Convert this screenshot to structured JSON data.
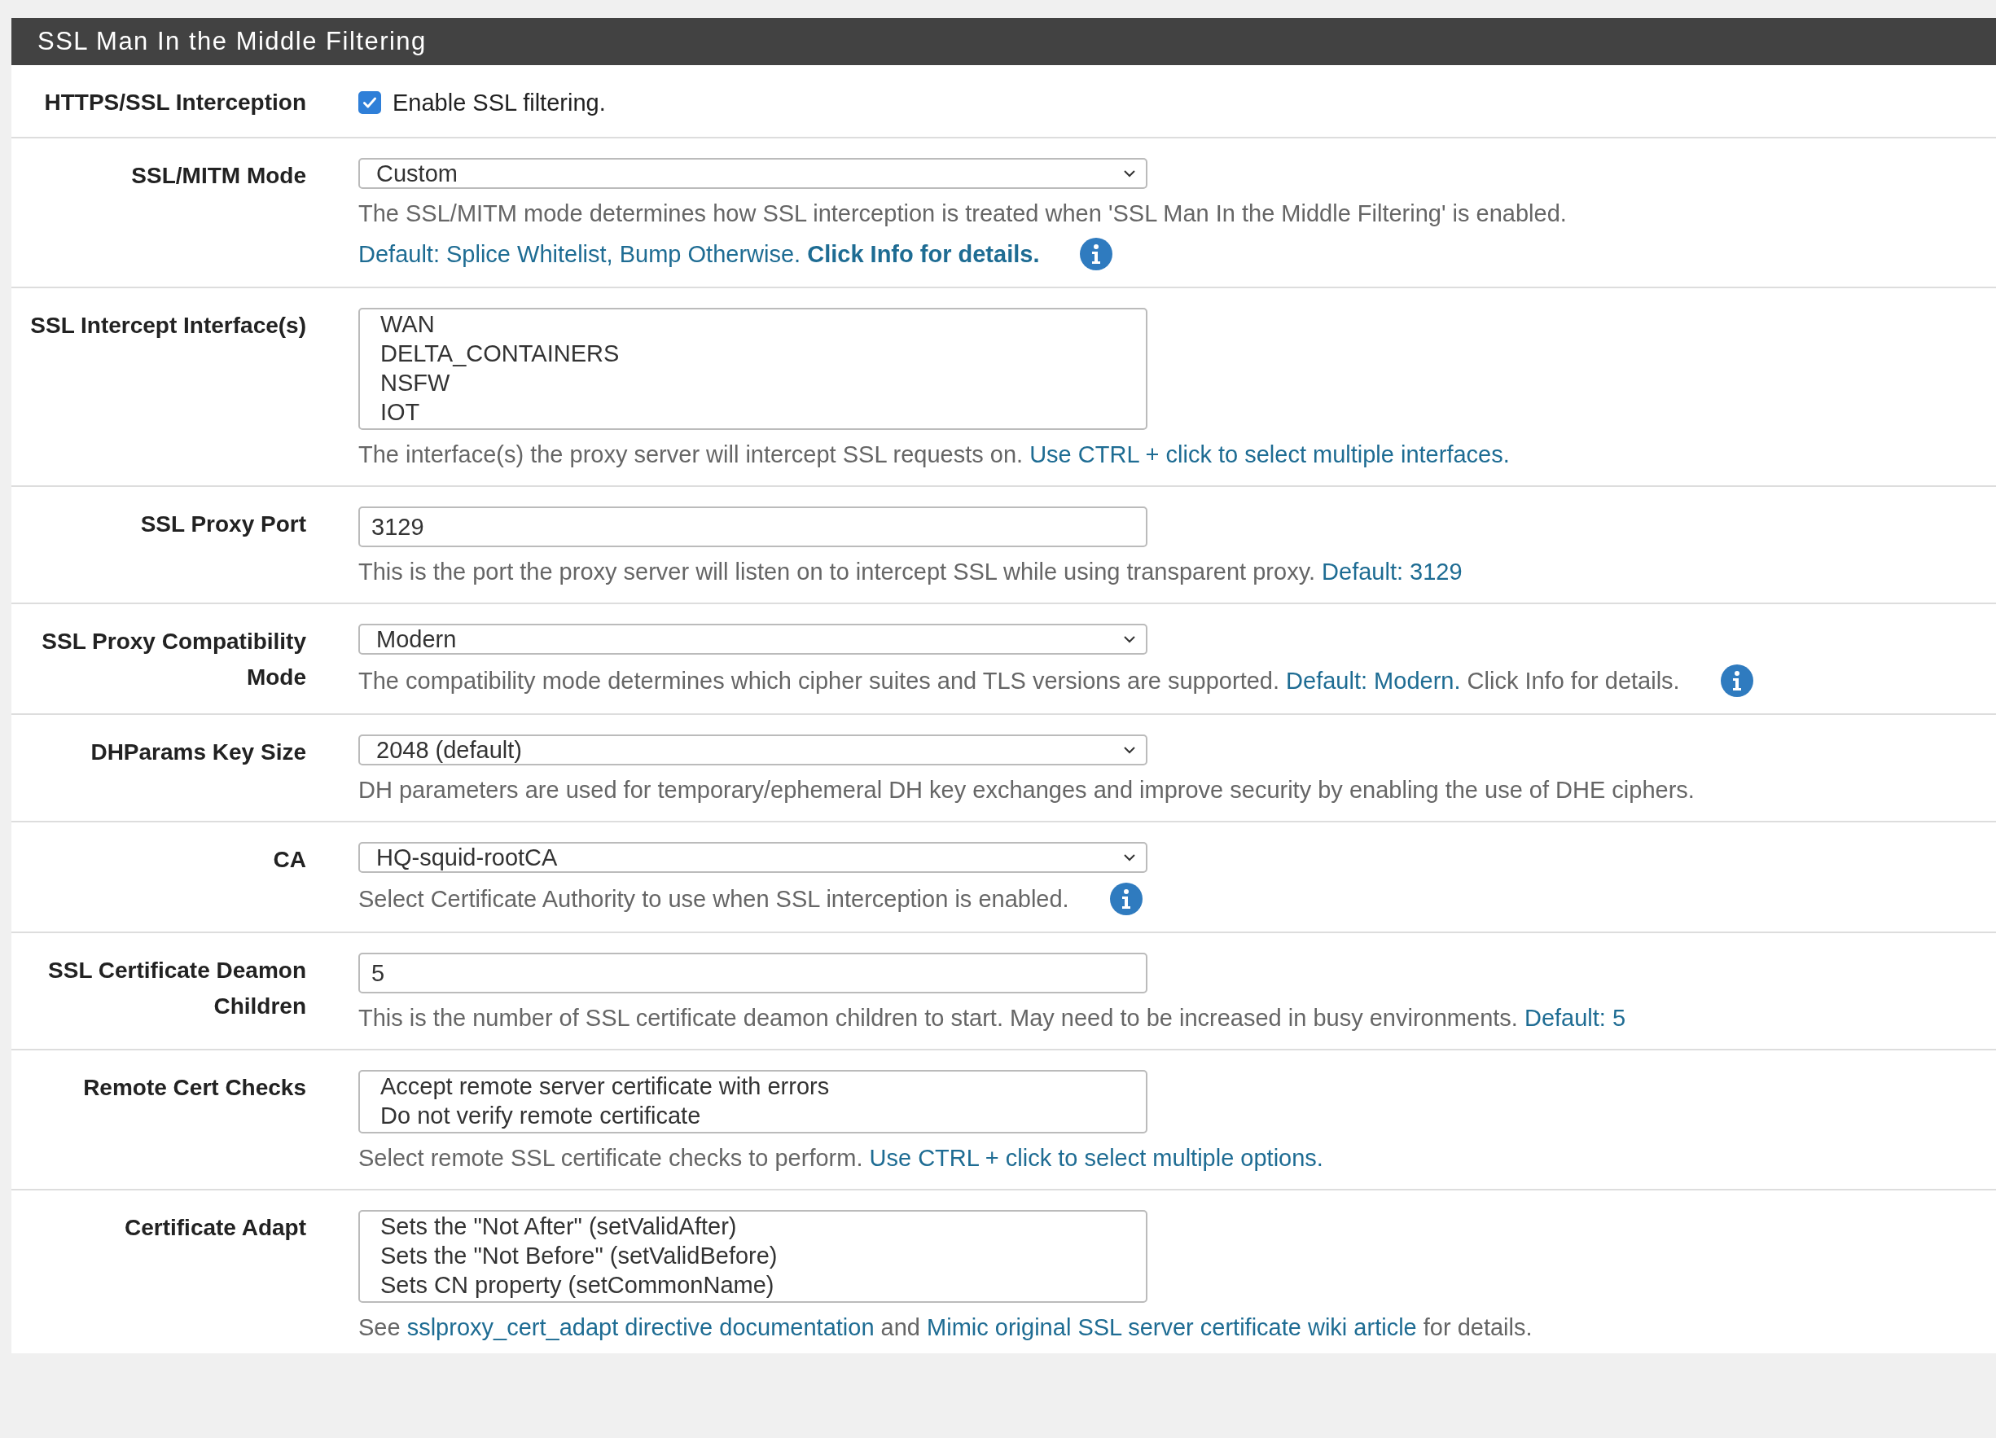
{
  "panel": {
    "title": "SSL Man In the Middle Filtering"
  },
  "fields": [
    {
      "label": "HTTPS/SSL Interception",
      "control": {
        "kind": "checkbox",
        "checked": true,
        "text": "Enable SSL filtering."
      },
      "info": false
    },
    {
      "label": "SSL/MITM Mode",
      "control": {
        "kind": "select",
        "value": "Custom"
      },
      "help": [
        [
          {
            "kind": "plain",
            "text": "The SSL/MITM mode determines how SSL interception is treated when 'SSL Man In the Middle Filtering' is enabled."
          }
        ],
        [
          {
            "kind": "link",
            "text": "Default: Splice Whitelist, Bump Otherwise."
          },
          {
            "kind": "strong-link",
            "text": "Click Info for details."
          }
        ]
      ],
      "info": true
    },
    {
      "label": "SSL Intercept Interface(s)",
      "control": {
        "kind": "multiselect",
        "options": [
          "WAN",
          "DELTA_CONTAINERS",
          "NSFW",
          "IOT"
        ]
      },
      "help": [
        [
          {
            "kind": "plain",
            "text": "The interface(s) the proxy server will intercept SSL requests on."
          },
          {
            "kind": "link",
            "text": "Use CTRL + click to select multiple interfaces."
          }
        ]
      ],
      "info": false
    },
    {
      "label": "SSL Proxy Port",
      "control": {
        "kind": "input",
        "value": "3129"
      },
      "help": [
        [
          {
            "kind": "plain",
            "text": "This is the port the proxy server will listen on to intercept SSL while using transparent proxy."
          },
          {
            "kind": "link",
            "text": "Default: 3129"
          }
        ]
      ],
      "info": false
    },
    {
      "label": "SSL Proxy Compatibility Mode",
      "control": {
        "kind": "select",
        "value": "Modern"
      },
      "help": [
        [
          {
            "kind": "plain",
            "text": "The compatibility mode determines which cipher suites and TLS versions are supported."
          },
          {
            "kind": "link",
            "text": "Default: Modern."
          },
          {
            "kind": "plain",
            "text": "Click Info for details."
          }
        ]
      ],
      "info": true
    },
    {
      "label": "DHParams Key Size",
      "control": {
        "kind": "select",
        "value": "2048 (default)"
      },
      "help": [
        [
          {
            "kind": "plain",
            "text": "DH parameters are used for temporary/ephemeral DH key exchanges and improve security by enabling the use of DHE ciphers."
          }
        ]
      ],
      "info": false
    },
    {
      "label": "CA",
      "control": {
        "kind": "select",
        "value": "HQ-squid-rootCA"
      },
      "help": [
        [
          {
            "kind": "plain",
            "text": "Select Certificate Authority to use when SSL interception is enabled."
          }
        ]
      ],
      "info": true
    },
    {
      "label": "SSL Certificate Deamon Children",
      "control": {
        "kind": "input",
        "value": "5"
      },
      "help": [
        [
          {
            "kind": "plain",
            "text": "This is the number of SSL certificate deamon children to start. May need to be increased in busy environments."
          },
          {
            "kind": "link",
            "text": "Default: 5"
          }
        ]
      ],
      "info": false
    },
    {
      "label": "Remote Cert Checks",
      "control": {
        "kind": "multiselect",
        "options": [
          "Accept remote server certificate with errors",
          "Do not verify remote certificate"
        ]
      },
      "help": [
        [
          {
            "kind": "plain",
            "text": "Select remote SSL certificate checks to perform."
          },
          {
            "kind": "link",
            "text": "Use CTRL + click to select multiple options."
          }
        ]
      ],
      "info": false
    },
    {
      "label": "Certificate Adapt",
      "control": {
        "kind": "multiselect",
        "options": [
          "Sets the \"Not After\" (setValidAfter)",
          "Sets the \"Not Before\" (setValidBefore)",
          "Sets CN property (setCommonName)"
        ]
      },
      "help": [
        [
          {
            "kind": "plain",
            "text": "See"
          },
          {
            "kind": "link",
            "text": "sslproxy_cert_adapt directive documentation"
          },
          {
            "kind": "plain",
            "text": "and"
          },
          {
            "kind": "link",
            "text": "Mimic original SSL server certificate wiki article"
          },
          {
            "kind": "plain",
            "text": "for details."
          }
        ]
      ],
      "info": false
    }
  ]
}
